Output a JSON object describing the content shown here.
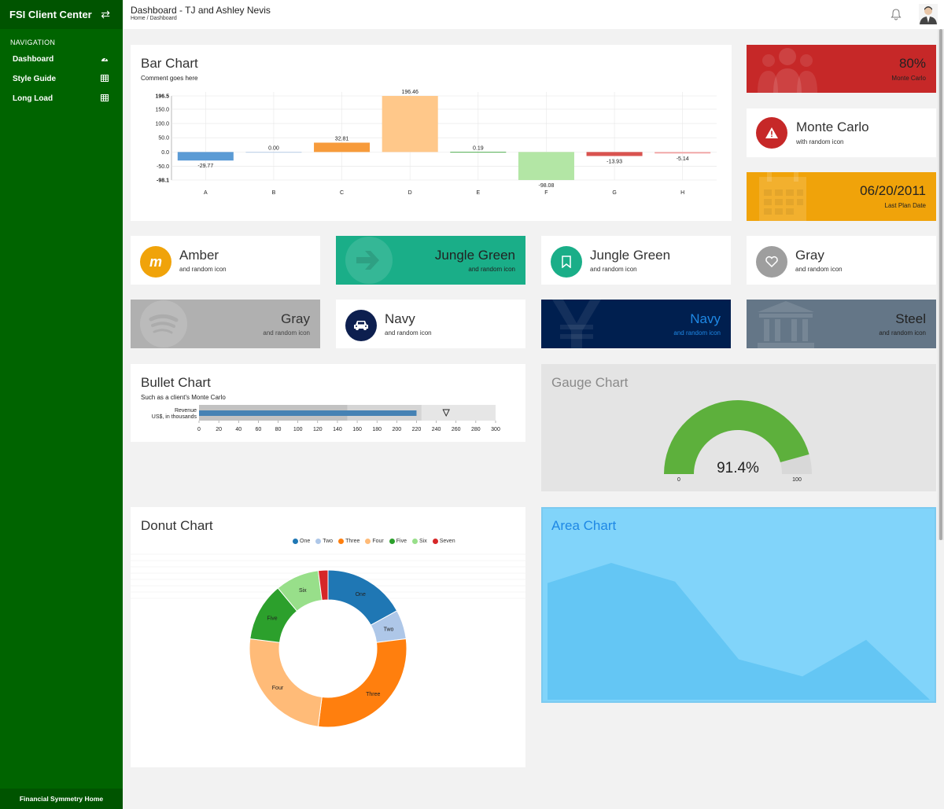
{
  "app": {
    "title": "FSI Client Center",
    "footer": "Financial Symmetry Home"
  },
  "nav": {
    "label": "NAVIGATION",
    "items": [
      {
        "label": "Dashboard",
        "icon": "tachometer-icon"
      },
      {
        "label": "Style Guide",
        "icon": "table-icon"
      },
      {
        "label": "Long Load",
        "icon": "table-icon"
      }
    ]
  },
  "header": {
    "title": "Dashboard - TJ and Ashley Nevis",
    "breadcrumb": "Home / Dashboard"
  },
  "bar_card": {
    "title": "Bar Chart",
    "subtitle": "Comment goes here"
  },
  "tiles": {
    "pct": {
      "value": "80%",
      "label": "Monte Carlo",
      "color": "#c62828",
      "icon": "users-icon"
    },
    "monte": {
      "title": "Monte Carlo",
      "sub": "with random icon",
      "icon": "warning-icon",
      "color": "#c62828"
    },
    "date": {
      "value": "06/20/2011",
      "label": "Last Plan Date",
      "color": "#f0a30a",
      "icon": "calendar-icon"
    },
    "amber": {
      "title": "Amber",
      "sub": "and random icon",
      "icon": "m-logo-icon",
      "color": "#f0a30a"
    },
    "jungle1": {
      "title": "Jungle Green",
      "sub": "and random icon",
      "icon": "arrow-right-icon",
      "color": "#1aae88"
    },
    "jungle2": {
      "title": "Jungle Green",
      "sub": "and random icon",
      "icon": "bookmark-icon",
      "color": "#1aae88"
    },
    "gray1": {
      "title": "Gray",
      "sub": "and random icon",
      "icon": "heart-icon",
      "color": "#9e9e9e"
    },
    "gray2": {
      "title": "Gray",
      "sub": "and random icon",
      "icon": "spotify-icon",
      "color": "#b0b0b0"
    },
    "navy1": {
      "title": "Navy",
      "sub": "and random icon",
      "icon": "car-icon",
      "color": "#0d1f4f"
    },
    "navy2": {
      "title": "Navy",
      "sub": "and random icon",
      "icon": "ruble-icon",
      "color": "#001f4f"
    },
    "steel": {
      "title": "Steel",
      "sub": "and random icon",
      "icon": "bank-icon",
      "color": "#647687"
    }
  },
  "bullet_card": {
    "title": "Bullet Chart",
    "subtitle": "Such as a client's Monte Carlo"
  },
  "gauge_card": {
    "title": "Gauge Chart"
  },
  "donut_card": {
    "title": "Donut Chart"
  },
  "area_card": {
    "title": "Area Chart"
  },
  "chart_data": [
    {
      "type": "bar",
      "title": "Bar Chart",
      "categories": [
        "A",
        "B",
        "C",
        "D",
        "E",
        "F",
        "G",
        "H"
      ],
      "values": [
        -29.77,
        0.0,
        32.81,
        196.46,
        0.19,
        -98.08,
        -13.93,
        -5.14
      ],
      "value_labels": [
        "-29.77",
        "0.00",
        "32.81",
        "196.46",
        "0.19",
        "-98.08",
        "-13.93",
        "-5.14"
      ],
      "colors": [
        "#5b9bd5",
        "#aec7e8",
        "#f79b3b",
        "#ffc88a",
        "#2ca02c",
        "#b3e6a5",
        "#d9534f",
        "#f4a6a6"
      ],
      "yticks": [
        "196.5",
        "150.0",
        "100.0",
        "50.0",
        "0.0",
        "-50.0",
        "-98.1"
      ],
      "ylim": [
        -98.1,
        196.5
      ]
    },
    {
      "type": "bullet",
      "title": "Bullet Chart",
      "label": "Revenue",
      "sublabel": "US$, in thousands",
      "ranges": [
        150,
        225,
        300
      ],
      "measure": 220,
      "marker": 250,
      "ticks": [
        "0",
        "20",
        "40",
        "60",
        "80",
        "100",
        "120",
        "140",
        "160",
        "180",
        "200",
        "220",
        "240",
        "260",
        "280",
        "300"
      ],
      "xlim": [
        0,
        300
      ]
    },
    {
      "type": "gauge",
      "title": "Gauge Chart",
      "value": 91.4,
      "display": "91.4%",
      "min": 0,
      "max": 100,
      "min_label": "0",
      "max_label": "100",
      "color": "#5db03c"
    },
    {
      "type": "pie",
      "title": "Donut Chart",
      "labels": [
        "One",
        "Two",
        "Three",
        "Four",
        "Five",
        "Six",
        "Seven"
      ],
      "values": [
        17,
        6,
        29,
        25,
        12,
        9,
        2
      ],
      "colors": [
        "#1f77b4",
        "#aec7e8",
        "#ff7f0e",
        "#ffbb78",
        "#2ca02c",
        "#98df8a",
        "#d62728"
      ]
    },
    {
      "type": "area",
      "title": "Area Chart",
      "x": [
        0,
        1,
        2,
        3,
        4,
        5,
        6
      ],
      "values": [
        150,
        176,
        152,
        52,
        30,
        77,
        0
      ],
      "ylim": [
        0,
        180
      ],
      "color": "#5fc3f2"
    }
  ]
}
